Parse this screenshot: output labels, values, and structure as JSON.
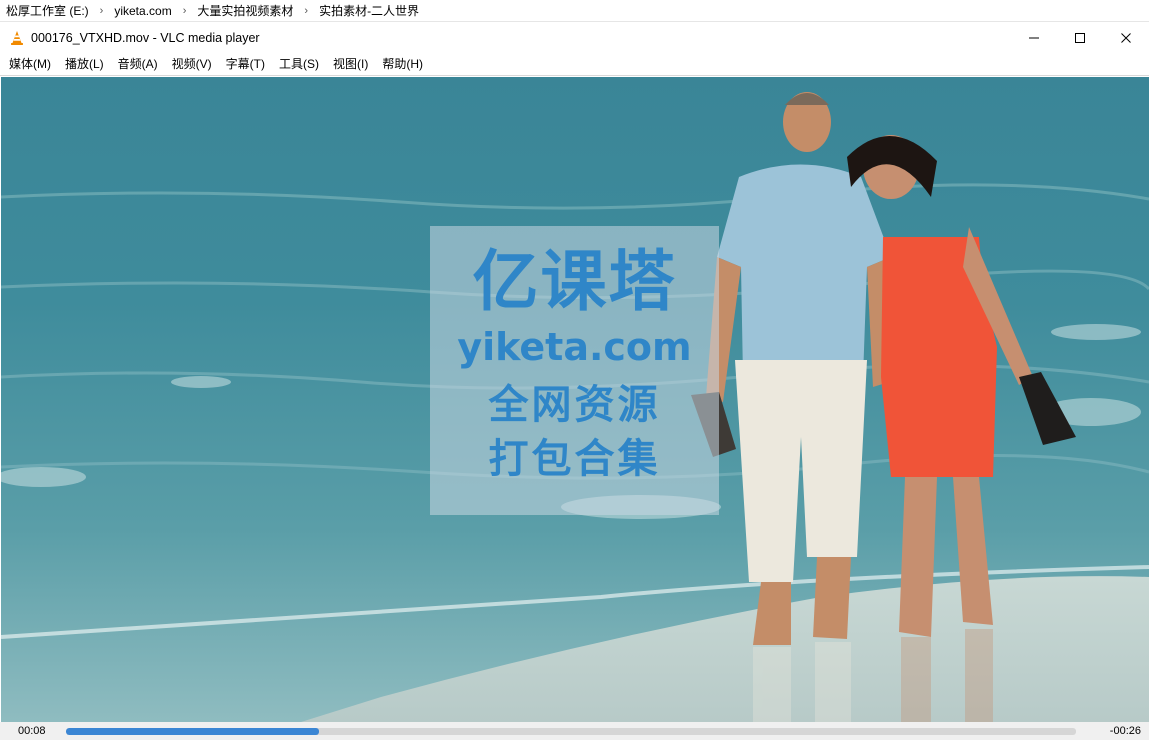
{
  "breadcrumb": {
    "items": [
      "松厚工作室 (E:)",
      "yiketa.com",
      "大量实拍视频素材",
      "实拍素材-二人世界"
    ]
  },
  "window": {
    "title": "000176_VTXHD.mov - VLC media player",
    "icon": "vlc-cone-icon",
    "controls": [
      "minimize-icon",
      "maximize-icon",
      "close-icon"
    ]
  },
  "menu": {
    "items": [
      "媒体(M)",
      "播放(L)",
      "音频(A)",
      "视频(V)",
      "字幕(T)",
      "工具(S)",
      "视图(I)",
      "帮助(H)"
    ]
  },
  "watermark": {
    "line1": "亿课塔",
    "line2": "yiketa.com",
    "line3": "全网资源",
    "line4": "打包合集"
  },
  "playback": {
    "elapsed": "00:08",
    "remaining": "-00:26",
    "progress": 0.25,
    "accent_color": "#3b86d4"
  }
}
